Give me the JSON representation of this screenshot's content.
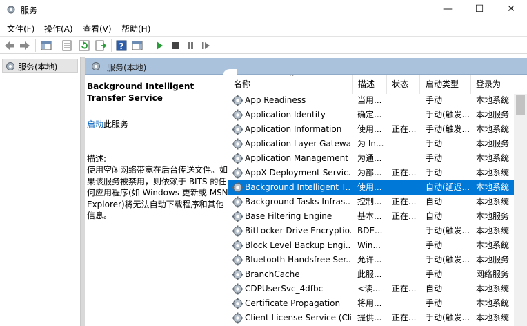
{
  "window": {
    "title": "服务",
    "minimize_glyph": "—",
    "maximize_glyph": "☐",
    "close_glyph": "✕"
  },
  "menu": [
    {
      "label": "文件(F)"
    },
    {
      "label": "操作(A)"
    },
    {
      "label": "查看(V)"
    },
    {
      "label": "帮助(H)"
    }
  ],
  "toolbar": {
    "buttons": [
      "back-icon",
      "forward-icon",
      "show-console-tree-icon",
      "properties-icon",
      "refresh-icon",
      "export-list-icon",
      "help-icon",
      "show-hide-action-pane-icon",
      "start-service-icon",
      "stop-service-icon",
      "pause-service-icon",
      "restart-service-icon"
    ]
  },
  "tree": {
    "item_label": "服务(本地)"
  },
  "content_header": {
    "label": "服务(本地)"
  },
  "description": {
    "title": "Background Intelligent Transfer Service",
    "action_link": "启动",
    "action_suffix": "此服务",
    "label": "描述:",
    "text": "使用空闲网络带宽在后台传送文件。如果该服务被禁用，则依赖于 BITS 的任何应用程序(如 Windows 更新或 MSN Explorer)将无法自动下载程序和其他信息。"
  },
  "columns": {
    "name": "名称",
    "desc": "描述",
    "status": "状态",
    "startup": "启动类型",
    "logon": "登录为",
    "sort_glyph": "^"
  },
  "services": [
    {
      "name": "App Readiness",
      "desc": "当用...",
      "status": "",
      "startup": "手动",
      "logon": "本地系统",
      "selected": false
    },
    {
      "name": "Application Identity",
      "desc": "确定...",
      "status": "",
      "startup": "手动(触发...",
      "logon": "本地服务",
      "selected": false
    },
    {
      "name": "Application Information",
      "desc": "使用...",
      "status": "正在...",
      "startup": "手动(触发...",
      "logon": "本地系统",
      "selected": false
    },
    {
      "name": "Application Layer Gatewa...",
      "desc": "为 In...",
      "status": "",
      "startup": "手动",
      "logon": "本地服务",
      "selected": false
    },
    {
      "name": "Application Management",
      "desc": "为通...",
      "status": "",
      "startup": "手动",
      "logon": "本地系统",
      "selected": false
    },
    {
      "name": "AppX Deployment Servic...",
      "desc": "为部...",
      "status": "正在...",
      "startup": "手动",
      "logon": "本地系统",
      "selected": false
    },
    {
      "name": "Background Intelligent T...",
      "desc": "使用...",
      "status": "",
      "startup": "自动(延迟...",
      "logon": "本地系统",
      "selected": true
    },
    {
      "name": "Background Tasks Infras...",
      "desc": "控制...",
      "status": "正在...",
      "startup": "自动",
      "logon": "本地系统",
      "selected": false
    },
    {
      "name": "Base Filtering Engine",
      "desc": "基本...",
      "status": "正在...",
      "startup": "自动",
      "logon": "本地服务",
      "selected": false
    },
    {
      "name": "BitLocker Drive Encryptio...",
      "desc": "BDE...",
      "status": "",
      "startup": "手动(触发...",
      "logon": "本地系统",
      "selected": false
    },
    {
      "name": "Block Level Backup Engi...",
      "desc": "Win...",
      "status": "",
      "startup": "手动",
      "logon": "本地系统",
      "selected": false
    },
    {
      "name": "Bluetooth Handsfree Ser...",
      "desc": "允许...",
      "status": "",
      "startup": "手动(触发...",
      "logon": "本地服务",
      "selected": false
    },
    {
      "name": "BranchCache",
      "desc": "此服...",
      "status": "",
      "startup": "手动",
      "logon": "网络服务",
      "selected": false
    },
    {
      "name": "CDPUserSvc_4dfbc",
      "desc": "<读...",
      "status": "正在...",
      "startup": "自动",
      "logon": "本地系统",
      "selected": false
    },
    {
      "name": "Certificate Propagation",
      "desc": "将用...",
      "status": "",
      "startup": "手动",
      "logon": "本地系统",
      "selected": false
    },
    {
      "name": "Client License Service (Cli...",
      "desc": "提供...",
      "status": "正在...",
      "startup": "手动(触发...",
      "logon": "本地系统",
      "selected": false
    }
  ],
  "colors": {
    "selection": "#0078d7",
    "header_band": "#abc2dc",
    "link": "#0563c1",
    "start_green": "#2a9d3a"
  }
}
